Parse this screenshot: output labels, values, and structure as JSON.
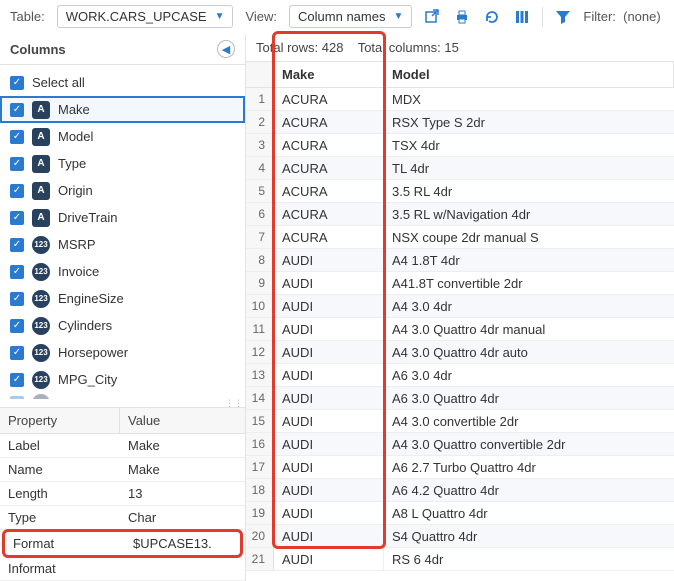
{
  "toolbar": {
    "table_label": "Table:",
    "table_value": "WORK.CARS_UPCASE",
    "view_label": "View:",
    "view_value": "Column names",
    "filter_label": "Filter:",
    "filter_value": "(none)"
  },
  "left": {
    "title": "Columns",
    "select_all": "Select all",
    "columns": [
      {
        "name": "Make",
        "type": "char",
        "selected": true
      },
      {
        "name": "Model",
        "type": "char",
        "selected": false
      },
      {
        "name": "Type",
        "type": "char",
        "selected": false
      },
      {
        "name": "Origin",
        "type": "char",
        "selected": false
      },
      {
        "name": "DriveTrain",
        "type": "char",
        "selected": false
      },
      {
        "name": "MSRP",
        "type": "num",
        "selected": false
      },
      {
        "name": "Invoice",
        "type": "num",
        "selected": false
      },
      {
        "name": "EngineSize",
        "type": "num",
        "selected": false
      },
      {
        "name": "Cylinders",
        "type": "num",
        "selected": false
      },
      {
        "name": "Horsepower",
        "type": "num",
        "selected": false
      },
      {
        "name": "MPG_City",
        "type": "num",
        "selected": false
      }
    ],
    "properties_header": {
      "prop": "Property",
      "val": "Value"
    },
    "properties": [
      {
        "label": "Label",
        "value": "Make",
        "hl": false
      },
      {
        "label": "Name",
        "value": "Make",
        "hl": false
      },
      {
        "label": "Length",
        "value": "13",
        "hl": false
      },
      {
        "label": "Type",
        "value": "Char",
        "hl": false
      },
      {
        "label": "Format",
        "value": "$UPCASE13.",
        "hl": true
      },
      {
        "label": "Informat",
        "value": "",
        "hl": false
      }
    ]
  },
  "right": {
    "summary_rows_label": "Total rows:",
    "summary_rows_value": "428",
    "summary_cols_label": "Total columns:",
    "summary_cols_value": "15",
    "headers": {
      "make": "Make",
      "model": "Model"
    },
    "rows": [
      {
        "n": "1",
        "make": "ACURA",
        "model": "MDX"
      },
      {
        "n": "2",
        "make": "ACURA",
        "model": "RSX Type S 2dr"
      },
      {
        "n": "3",
        "make": "ACURA",
        "model": "TSX 4dr"
      },
      {
        "n": "4",
        "make": "ACURA",
        "model": "TL 4dr"
      },
      {
        "n": "5",
        "make": "ACURA",
        "model": "3.5 RL 4dr"
      },
      {
        "n": "6",
        "make": "ACURA",
        "model": "3.5 RL w/Navigation 4dr"
      },
      {
        "n": "7",
        "make": "ACURA",
        "model": "NSX coupe 2dr manual S"
      },
      {
        "n": "8",
        "make": "AUDI",
        "model": "A4 1.8T 4dr"
      },
      {
        "n": "9",
        "make": "AUDI",
        "model": "A41.8T convertible 2dr"
      },
      {
        "n": "10",
        "make": "AUDI",
        "model": "A4 3.0 4dr"
      },
      {
        "n": "11",
        "make": "AUDI",
        "model": "A4 3.0 Quattro 4dr manual"
      },
      {
        "n": "12",
        "make": "AUDI",
        "model": "A4 3.0 Quattro 4dr auto"
      },
      {
        "n": "13",
        "make": "AUDI",
        "model": "A6 3.0 4dr"
      },
      {
        "n": "14",
        "make": "AUDI",
        "model": "A6 3.0 Quattro 4dr"
      },
      {
        "n": "15",
        "make": "AUDI",
        "model": "A4 3.0 convertible 2dr"
      },
      {
        "n": "16",
        "make": "AUDI",
        "model": "A4 3.0 Quattro convertible 2dr"
      },
      {
        "n": "17",
        "make": "AUDI",
        "model": "A6 2.7 Turbo Quattro 4dr"
      },
      {
        "n": "18",
        "make": "AUDI",
        "model": "A6 4.2 Quattro 4dr"
      },
      {
        "n": "19",
        "make": "AUDI",
        "model": "A8 L Quattro 4dr"
      },
      {
        "n": "20",
        "make": "AUDI",
        "model": "S4 Quattro 4dr"
      },
      {
        "n": "21",
        "make": "AUDI",
        "model": "RS 6 4dr"
      }
    ]
  }
}
